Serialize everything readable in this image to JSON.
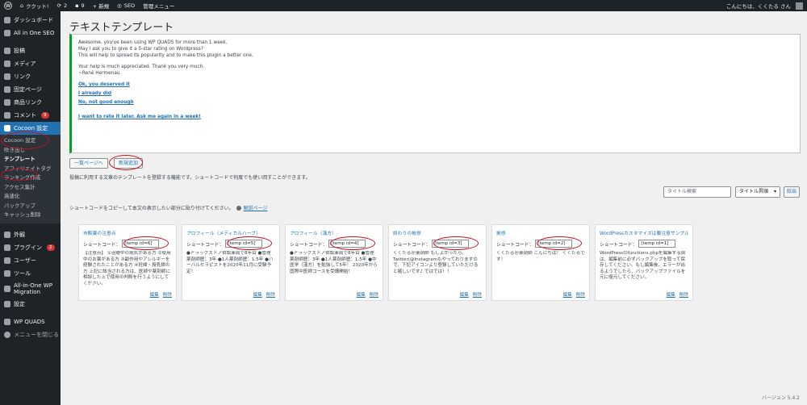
{
  "adminbar": {
    "site_name": "ククット!",
    "comments_count": "2",
    "new_count": "9",
    "new_label": "+ 新規",
    "seo_label": "SEO",
    "admin_menu_label": "管理メニュー",
    "greeting": "こんにちは、くくたる さん"
  },
  "sidebar": {
    "items_top": [
      {
        "label": "ダッシュボード",
        "icon": "dashboard-icon"
      },
      {
        "label": "All in One SEO",
        "icon": "seo-icon"
      }
    ],
    "items_mid": [
      {
        "label": "投稿",
        "icon": "pin-icon"
      },
      {
        "label": "メディア",
        "icon": "media-icon"
      },
      {
        "label": "リンク",
        "icon": "link-icon"
      },
      {
        "label": "固定ページ",
        "icon": "page-icon"
      },
      {
        "label": "商品リンク",
        "icon": "product-icon"
      },
      {
        "label": "コメント",
        "icon": "comment-icon",
        "badge": "9"
      }
    ],
    "current": {
      "label": "Cocoon 設定",
      "icon": "cocoon-icon"
    },
    "submenu": [
      "Cocoon 設定",
      "吹き出し",
      "テンプレート",
      "アフィリエイトタグ",
      "ランキング作成",
      "アクセス集計",
      "高速化",
      "バックアップ",
      "キャッシュ削除"
    ],
    "items_bottom": [
      {
        "label": "外観",
        "icon": "appearance-icon"
      },
      {
        "label": "プラグイン",
        "icon": "plugin-icon",
        "badge": "2"
      },
      {
        "label": "ユーザー",
        "icon": "user-icon"
      },
      {
        "label": "ツール",
        "icon": "tools-icon"
      },
      {
        "label": "All-in-One WP Migration",
        "icon": "migration-icon"
      },
      {
        "label": "設定",
        "icon": "settings-icon"
      }
    ],
    "wpquads": {
      "label": "WP QUADS",
      "icon": "quads-icon"
    },
    "collapse": {
      "label": "メニューを閉じる",
      "icon": "collapse-icon"
    }
  },
  "main": {
    "title": "テキストテンプレート",
    "notice": {
      "line1": "Awesome, you've been using WP QUADS for more than 1 week.",
      "line2": "May i ask you to give it a 5-star rating on Wordpress?",
      "line3": "This will help to spread its popularity and to make this plugin a better one.",
      "line4": "Your help is much appreciated. Thank you very much.",
      "line5": "~René Hermenau",
      "link1": "Ok, you deserved it",
      "link2": "I already did",
      "link3": "No, not good enough",
      "link4": "I want to rate it later. Ask me again in a week!"
    },
    "btn_list": "一覧ページへ",
    "btn_new": "新規追加",
    "description": "投稿に利用する文章のテンプレートを登録する機能です。ショートコードで何度でも使い回すことができます。",
    "search_placeholder": "タイトル検索",
    "sort_select": "タイトル昇順",
    "filter_btn": "絞出",
    "hint": "ショートコードをコピーして本文の表示したい部分に貼り付けてください。",
    "hint_link": "解説ページ",
    "shortcode_label": "ショートコード：",
    "edit_label": "編集",
    "delete_label": "削除",
    "cards": [
      {
        "title": "市販薬の注意点",
        "code": "[temp id=6]",
        "body": "【注意点】 ①治療中の病気がある方 ②使用中のお薬がある方 ③副作用やアレルギーを経験されたことがある方 ④妊婦・授乳婦の方 上記に該当される方は、医師や薬剤師に相談した上で使用の判断を行うようにしてください。"
      },
      {
        "title": "プロフィール（メディカルハーブ）",
        "code": "[temp id=5]",
        "body": "●ドラッグストア併設薬局で8年目 ●管理薬剤師歴：3年 ●1人薬剤師歴：1.5年 ●ハーバルセラピストを2020年11月に受験予定！"
      },
      {
        "title": "プロフィール（漢方）",
        "code": "[temp id=4]",
        "body": "●ドラッグストア併設薬局で8年目 ●管理薬剤師歴：3年 ●1人薬剤師歴：1.5年 ●中医学（漢方）を勉強して5年！ 2020年から国際中医師コースを受講開始！"
      },
      {
        "title": "終わりの挨拶",
        "code": "[temp id=3]",
        "body": "くくたる＠薬剤師 もしよかったら、Twitter(@Instagramもやっておりますので、下記アイコンより登録していただけると嬉しいです♪ ではでは！！"
      },
      {
        "title": "挨拶",
        "code": "[temp id=2]",
        "body": "くくたる＠薬剤師 こんにちは！ くくたるです！"
      },
      {
        "title": "WordPressカスタマイズは要注意サンプル",
        "code": "[temp id=1]",
        "body": "WordPressのfunctions.phpを編集する前は、編集前に必ずバックアップを取って保存してください。もし編集後、エラーが出るようでしたら、バックアップファイルを元に復元してください。"
      }
    ]
  },
  "footer": {
    "version": "バージョン 5.4.2"
  }
}
